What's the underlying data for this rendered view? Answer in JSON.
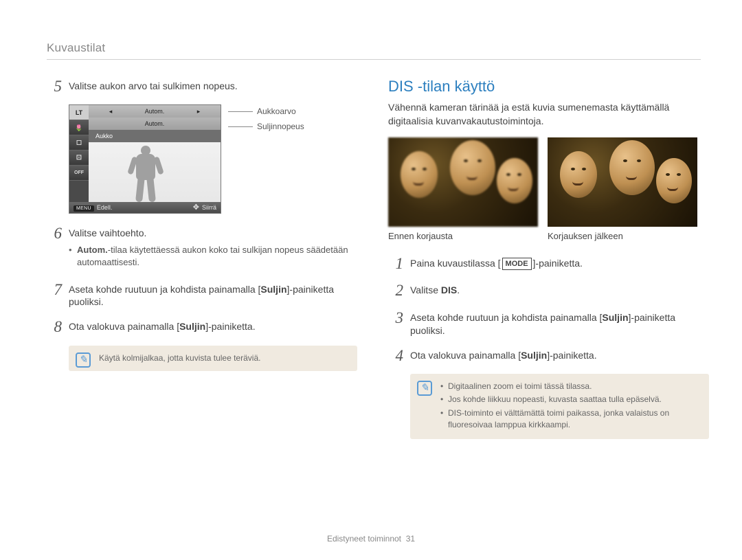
{
  "breadcrumb": "Kuvaustilat",
  "left": {
    "step5": "Valitse aukon arvo tai sulkimen nopeus.",
    "step6": "Valitse vaihtoehto.",
    "step6_bullet_prefix": "Autom.",
    "step6_bullet_rest": "-tilaa käytettäessä aukon koko tai sulkijan nopeus säädetään automaattisesti.",
    "step7_a": "Aseta kohde ruutuun ja kohdista painamalla [",
    "step7_b": "Suljin",
    "step7_c": "]-painiketta puoliksi.",
    "step8_a": "Ota valokuva painamalla [",
    "step8_b": "Suljin",
    "step8_c": "]-painiketta.",
    "note": "Käytä kolmijalkaa, jotta kuvista tulee teräviä.",
    "lcd": {
      "mode_lt": "LT",
      "aukko": "Aukko",
      "autom": "Autom.",
      "edell": "Edell.",
      "siirra": "Siirrä",
      "menu": "MENU",
      "off": "OFF",
      "legend_aukkoarvo": "Aukkoarvo",
      "legend_suljinnopeus": "Suljinnopeus"
    }
  },
  "right": {
    "heading": "DIS -tilan käyttö",
    "intro": "Vähennä kameran tärinää ja estä kuvia sumenemasta käyttämällä digitaalisia kuvanvakautustoimintoja.",
    "before": "Ennen korjausta",
    "after": "Korjauksen jälkeen",
    "step1_a": "Paina kuvaustilassa [",
    "step1_b": "MODE",
    "step1_c": "]-painiketta.",
    "step2_a": "Valitse ",
    "step2_b": "DIS",
    "step2_c": ".",
    "step3_a": "Aseta kohde ruutuun ja kohdista painamalla [",
    "step3_b": "Suljin",
    "step3_c": "]-painiketta puoliksi.",
    "step4_a": "Ota valokuva painamalla [",
    "step4_b": "Suljin",
    "step4_c": "]-painiketta.",
    "note_items": [
      "Digitaalinen zoom ei toimi tässä tilassa.",
      "Jos kohde liikkuu nopeasti, kuvasta saattaa tulla epäselvä.",
      "DIS-toiminto ei välttämättä toimi paikassa, jonka valaistus on fluoresoivaa lamppua kirkkaampi."
    ]
  },
  "footer_a": "Edistyneet toiminnot",
  "footer_b": "31"
}
